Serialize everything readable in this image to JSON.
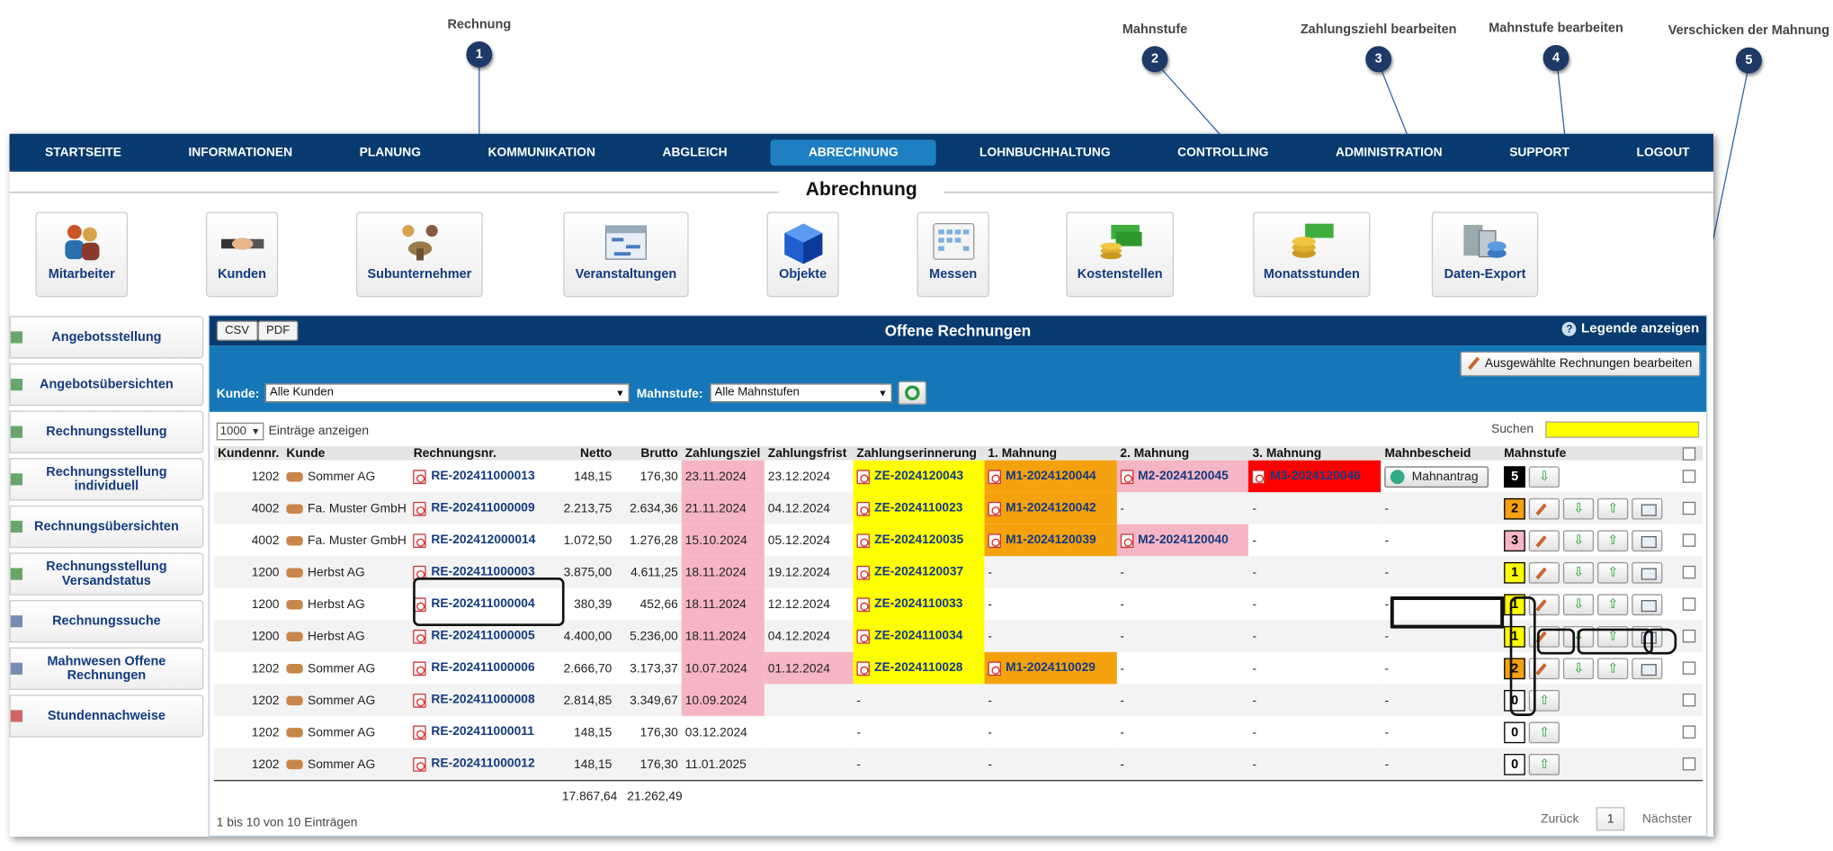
{
  "callouts": [
    {
      "label": "Rechnung",
      "num": "1"
    },
    {
      "label": "Mahnstufe",
      "num": "2"
    },
    {
      "label": "Zahlungsziehl bearbeiten",
      "num": "3"
    },
    {
      "label": "Mahnstufe bearbeiten",
      "num": "4"
    },
    {
      "label": "Verschicken der Mahnung",
      "num": "5"
    }
  ],
  "nav": [
    "STARTSEITE",
    "INFORMATIONEN",
    "PLANUNG",
    "KOMMUNIKATION",
    "ABGLEICH",
    "ABRECHNUNG",
    "LOHNBUCHHALTUNG",
    "CONTROLLING",
    "ADMINISTRATION",
    "SUPPORT",
    "LOGOUT"
  ],
  "nav_active": "ABRECHNUNG",
  "section_title": "Abrechnung",
  "modules": [
    "Mitarbeiter",
    "Kunden",
    "Subunternehmer",
    "Veranstaltungen",
    "Objekte",
    "Messen",
    "Kostenstellen",
    "Monatsstunden",
    "Daten-Export"
  ],
  "sidebar": [
    "Angebotsstellung",
    "Angebotsübersichten",
    "Rechnungsstellung",
    "Rechnungsstellung individuell",
    "Rechnungsübersichten",
    "Rechnungsstellung Versandstatus",
    "Rechnungssuche",
    "Mahnwesen Offene Rechnungen",
    "Stundennachweise"
  ],
  "panel": {
    "csv": "CSV",
    "pdf": "PDF",
    "title": "Offene Rechnungen",
    "legend": "Legende anzeigen",
    "edit_selected": "Ausgewählte Rechnungen bearbeiten",
    "kunde_label": "Kunde:",
    "kunde_value": "Alle Kunden",
    "mahnstufe_label": "Mahnstufe:",
    "mahnstufe_value": "Alle Mahnstufen",
    "length_value": "1000",
    "length_label": "Einträge anzeigen",
    "search_label": "Suchen",
    "info": "1 bis 10 von 10 Einträgen",
    "prev": "Zurück",
    "page": "1",
    "next": "Nächster",
    "total_netto": "17.867,64",
    "total_brutto": "21.262,49",
    "mahnantrag": "Mahnantrag"
  },
  "columns": [
    "Kundennr.",
    "Kunde",
    "Rechnungsnr.",
    "Netto",
    "Brutto",
    "Zahlungsziel",
    "Zahlungsfrist",
    "Zahlungserinnerung",
    "1. Mahnung",
    "2. Mahnung",
    "3. Mahnung",
    "Mahnbescheid",
    "Mahnstufe"
  ],
  "rows": [
    {
      "kundennr": "1202",
      "kunde": "Sommer AG",
      "rnr": "RE-202411000013",
      "netto": "148,15",
      "brutto": "176,30",
      "ziel": "23.11.2024",
      "ziel_color": "#f6b5c4",
      "frist": "23.12.2024",
      "frist_color": "",
      "ze": "ZE-2024120043",
      "m1": "M1-2024120044",
      "m2": "M2-2024120045",
      "m3": "M3-2024120046",
      "mb": "btn",
      "stufe": "5",
      "stufe_color": "#000000"
    },
    {
      "kundennr": "4002",
      "kunde": "Fa. Muster GmbH",
      "rnr": "RE-202411000009",
      "netto": "2.213,75",
      "brutto": "2.634,36",
      "ziel": "21.11.2024",
      "ziel_color": "#f6b5c4",
      "frist": "04.12.2024",
      "frist_color": "",
      "ze": "ZE-2024110023",
      "m1": "M1-2024120042",
      "m2": "-",
      "m3": "-",
      "mb": "-",
      "stufe": "2",
      "stufe_color": "#f5a10e"
    },
    {
      "kundennr": "4002",
      "kunde": "Fa. Muster GmbH",
      "rnr": "RE-202412000014",
      "netto": "1.072,50",
      "brutto": "1.276,28",
      "ziel": "15.10.2024",
      "ziel_color": "#f6b5c4",
      "frist": "05.12.2024",
      "frist_color": "",
      "ze": "ZE-2024120035",
      "m1": "M1-2024120039",
      "m2": "M2-2024120040",
      "m3": "-",
      "mb": "-",
      "stufe": "3",
      "stufe_color": "#f6b5c4"
    },
    {
      "kundennr": "1200",
      "kunde": "Herbst AG",
      "rnr": "RE-202411000003",
      "netto": "3.875,00",
      "brutto": "4.611,25",
      "ziel": "18.11.2024",
      "ziel_color": "#f6b5c4",
      "frist": "19.12.2024",
      "frist_color": "",
      "ze": "ZE-2024120037",
      "m1": "-",
      "m2": "-",
      "m3": "-",
      "mb": "-",
      "stufe": "1",
      "stufe_color": "#ffff00"
    },
    {
      "kundennr": "1200",
      "kunde": "Herbst AG",
      "rnr": "RE-202411000004",
      "netto": "380,39",
      "brutto": "452,66",
      "ziel": "18.11.2024",
      "ziel_color": "#f6b5c4",
      "frist": "12.12.2024",
      "frist_color": "",
      "ze": "ZE-2024110033",
      "m1": "-",
      "m2": "-",
      "m3": "-",
      "mb": "-",
      "stufe": "1",
      "stufe_color": "#ffff00"
    },
    {
      "kundennr": "1200",
      "kunde": "Herbst AG",
      "rnr": "RE-202411000005",
      "netto": "4.400,00",
      "brutto": "5.236,00",
      "ziel": "18.11.2024",
      "ziel_color": "#f6b5c4",
      "frist": "04.12.2024",
      "frist_color": "",
      "ze": "ZE-2024110034",
      "m1": "-",
      "m2": "-",
      "m3": "-",
      "mb": "-",
      "stufe": "1",
      "stufe_color": "#ffff00"
    },
    {
      "kundennr": "1202",
      "kunde": "Sommer AG",
      "rnr": "RE-202411000006",
      "netto": "2.666,70",
      "brutto": "3.173,37",
      "ziel": "10.07.2024",
      "ziel_color": "#f6b5c4",
      "frist": "01.12.2024",
      "frist_color": "#f6b5c4",
      "ze": "ZE-2024110028",
      "m1": "M1-2024110029",
      "m2": "-",
      "m3": "-",
      "mb": "-",
      "stufe": "2",
      "stufe_color": "#f5a10e"
    },
    {
      "kundennr": "1202",
      "kunde": "Sommer AG",
      "rnr": "RE-202411000008",
      "netto": "2.814,85",
      "brutto": "3.349,67",
      "ziel": "10.09.2024",
      "ziel_color": "#f6b5c4",
      "frist": "",
      "frist_color": "",
      "ze": "-",
      "m1": "-",
      "m2": "-",
      "m3": "-",
      "mb": "-",
      "stufe": "0",
      "stufe_color": "#ffffff"
    },
    {
      "kundennr": "1202",
      "kunde": "Sommer AG",
      "rnr": "RE-202411000011",
      "netto": "148,15",
      "brutto": "176,30",
      "ziel": "03.12.2024",
      "ziel_color": "",
      "frist": "",
      "frist_color": "",
      "ze": "-",
      "m1": "-",
      "m2": "-",
      "m3": "-",
      "mb": "-",
      "stufe": "0",
      "stufe_color": "#ffffff"
    },
    {
      "kundennr": "1202",
      "kunde": "Sommer AG",
      "rnr": "RE-202411000012",
      "netto": "148,15",
      "brutto": "176,30",
      "ziel": "11.01.2025",
      "ziel_color": "",
      "frist": "",
      "frist_color": "",
      "ze": "-",
      "m1": "-",
      "m2": "-",
      "m3": "-",
      "mb": "-",
      "stufe": "0",
      "stufe_color": "#ffffff"
    }
  ]
}
